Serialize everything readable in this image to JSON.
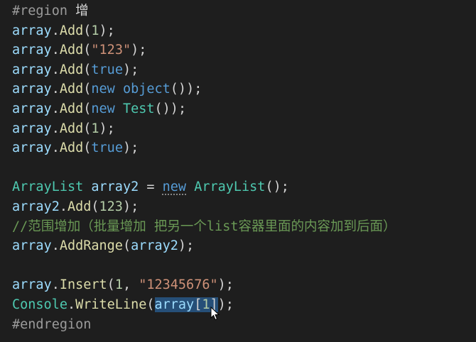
{
  "editor": {
    "lines": [
      [
        {
          "t": "#region",
          "c": "dir"
        },
        {
          "t": " 增",
          "c": "dir-text"
        }
      ],
      [
        {
          "t": "array",
          "c": "ident"
        },
        {
          "t": ".",
          "c": "punc"
        },
        {
          "t": "Add",
          "c": "method"
        },
        {
          "t": "(",
          "c": "punc"
        },
        {
          "t": "1",
          "c": "num"
        },
        {
          "t": ");",
          "c": "punc"
        }
      ],
      [
        {
          "t": "array",
          "c": "ident"
        },
        {
          "t": ".",
          "c": "punc"
        },
        {
          "t": "Add",
          "c": "method"
        },
        {
          "t": "(",
          "c": "punc"
        },
        {
          "t": "\"123\"",
          "c": "str"
        },
        {
          "t": ");",
          "c": "punc"
        }
      ],
      [
        {
          "t": "array",
          "c": "ident"
        },
        {
          "t": ".",
          "c": "punc"
        },
        {
          "t": "Add",
          "c": "method"
        },
        {
          "t": "(",
          "c": "punc"
        },
        {
          "t": "true",
          "c": "kw"
        },
        {
          "t": ");",
          "c": "punc"
        }
      ],
      [
        {
          "t": "array",
          "c": "ident"
        },
        {
          "t": ".",
          "c": "punc"
        },
        {
          "t": "Add",
          "c": "method"
        },
        {
          "t": "(",
          "c": "punc"
        },
        {
          "t": "new",
          "c": "kw"
        },
        {
          "t": " ",
          "c": "punc"
        },
        {
          "t": "object",
          "c": "kw"
        },
        {
          "t": "());",
          "c": "punc"
        }
      ],
      [
        {
          "t": "array",
          "c": "ident"
        },
        {
          "t": ".",
          "c": "punc"
        },
        {
          "t": "Add",
          "c": "method"
        },
        {
          "t": "(",
          "c": "punc"
        },
        {
          "t": "new",
          "c": "kw"
        },
        {
          "t": " ",
          "c": "punc"
        },
        {
          "t": "Test",
          "c": "type"
        },
        {
          "t": "());",
          "c": "punc"
        }
      ],
      [
        {
          "t": "array",
          "c": "ident"
        },
        {
          "t": ".",
          "c": "punc"
        },
        {
          "t": "Add",
          "c": "method"
        },
        {
          "t": "(",
          "c": "punc"
        },
        {
          "t": "1",
          "c": "num"
        },
        {
          "t": ");",
          "c": "punc"
        }
      ],
      [
        {
          "t": "array",
          "c": "ident"
        },
        {
          "t": ".",
          "c": "punc"
        },
        {
          "t": "Add",
          "c": "method"
        },
        {
          "t": "(",
          "c": "punc"
        },
        {
          "t": "true",
          "c": "kw"
        },
        {
          "t": ");",
          "c": "punc"
        }
      ],
      [],
      [
        {
          "t": "ArrayList",
          "c": "type"
        },
        {
          "t": " ",
          "c": "punc"
        },
        {
          "t": "array2",
          "c": "ident"
        },
        {
          "t": " = ",
          "c": "punc"
        },
        {
          "t": "new",
          "c": "kw",
          "squiggle": true
        },
        {
          "t": " ",
          "c": "punc"
        },
        {
          "t": "ArrayList",
          "c": "type"
        },
        {
          "t": "();",
          "c": "punc"
        }
      ],
      [
        {
          "t": "array2",
          "c": "ident"
        },
        {
          "t": ".",
          "c": "punc"
        },
        {
          "t": "Add",
          "c": "method"
        },
        {
          "t": "(",
          "c": "punc"
        },
        {
          "t": "123",
          "c": "num"
        },
        {
          "t": ");",
          "c": "punc"
        }
      ],
      [
        {
          "t": "//范围增加（批量增加 把另一个list容器里面的内容加到后面）",
          "c": "comment"
        }
      ],
      [
        {
          "t": "array",
          "c": "ident"
        },
        {
          "t": ".",
          "c": "punc"
        },
        {
          "t": "AddRange",
          "c": "method"
        },
        {
          "t": "(",
          "c": "punc"
        },
        {
          "t": "array2",
          "c": "ident"
        },
        {
          "t": ");",
          "c": "punc"
        }
      ],
      [],
      [
        {
          "t": "array",
          "c": "ident"
        },
        {
          "t": ".",
          "c": "punc"
        },
        {
          "t": "Insert",
          "c": "method"
        },
        {
          "t": "(",
          "c": "punc"
        },
        {
          "t": "1",
          "c": "num"
        },
        {
          "t": ", ",
          "c": "punc"
        },
        {
          "t": "\"12345676\"",
          "c": "str"
        },
        {
          "t": ");",
          "c": "punc"
        }
      ],
      [
        {
          "t": "Console",
          "c": "type"
        },
        {
          "t": ".",
          "c": "punc"
        },
        {
          "t": "WriteLine",
          "c": "method"
        },
        {
          "t": "(",
          "c": "punc"
        },
        {
          "t": "array",
          "c": "ident",
          "sel": true
        },
        {
          "t": "[",
          "c": "punc",
          "sel": true
        },
        {
          "t": "1",
          "c": "num",
          "sel": true
        },
        {
          "t": "]",
          "c": "punc",
          "sel": true
        },
        {
          "t": ");",
          "c": "punc"
        }
      ],
      [
        {
          "t": "#endregion",
          "c": "dir"
        }
      ]
    ]
  },
  "colors": {
    "background": "#1e1e1e",
    "selection": "#264f78"
  },
  "cursor": {
    "icon": "mouse-pointer-icon"
  }
}
